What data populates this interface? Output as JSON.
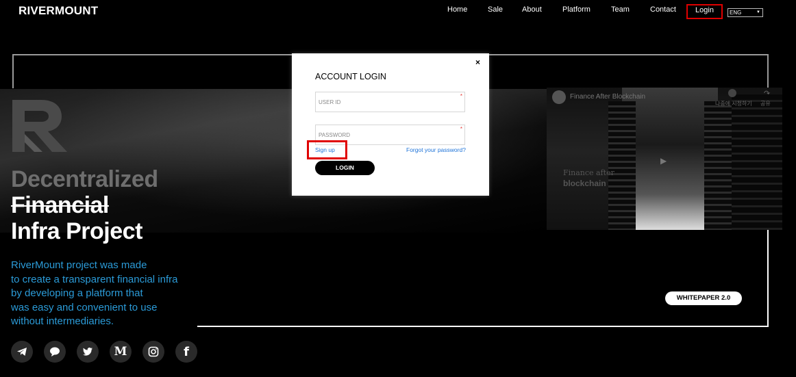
{
  "header": {
    "logo": "RIVERMOUNT",
    "nav": [
      "Home",
      "Sale",
      "About",
      "Platform",
      "Team",
      "Contact"
    ],
    "login_label": "Login",
    "language": "ENG"
  },
  "hero": {
    "title_line1": "Decentralized",
    "title_line2": "Financial",
    "title_line3": "Infra Project",
    "description": [
      "RiverMount project was made",
      "to create a transparent financial infra",
      "by developing a platform that",
      "was easy and convenient to use",
      "without intermediaries."
    ]
  },
  "social": [
    "telegram-icon",
    "chat-icon",
    "twitter-icon",
    "medium-icon",
    "instagram-icon",
    "facebook-icon"
  ],
  "video": {
    "title": "Finance After Blockchain",
    "watch_later": "나중에 시청하기",
    "share": "공유",
    "caption_line1": "Finance after",
    "caption_line2": "blockchain"
  },
  "whitepaper_label": "WHITEPAPER 2.0",
  "modal": {
    "close": "×",
    "title": "ACCOUNT LOGIN",
    "user_id_placeholder": "USER ID",
    "password_placeholder": "PASSWORD",
    "required_mark": "*",
    "signup_label": "Sign up",
    "forgot_label": "Forgot your password?",
    "login_button": "LOGIN"
  },
  "colors": {
    "accent_blue": "#2b9bd8",
    "highlight_red": "#e00000",
    "link_blue": "#1e73d8"
  }
}
